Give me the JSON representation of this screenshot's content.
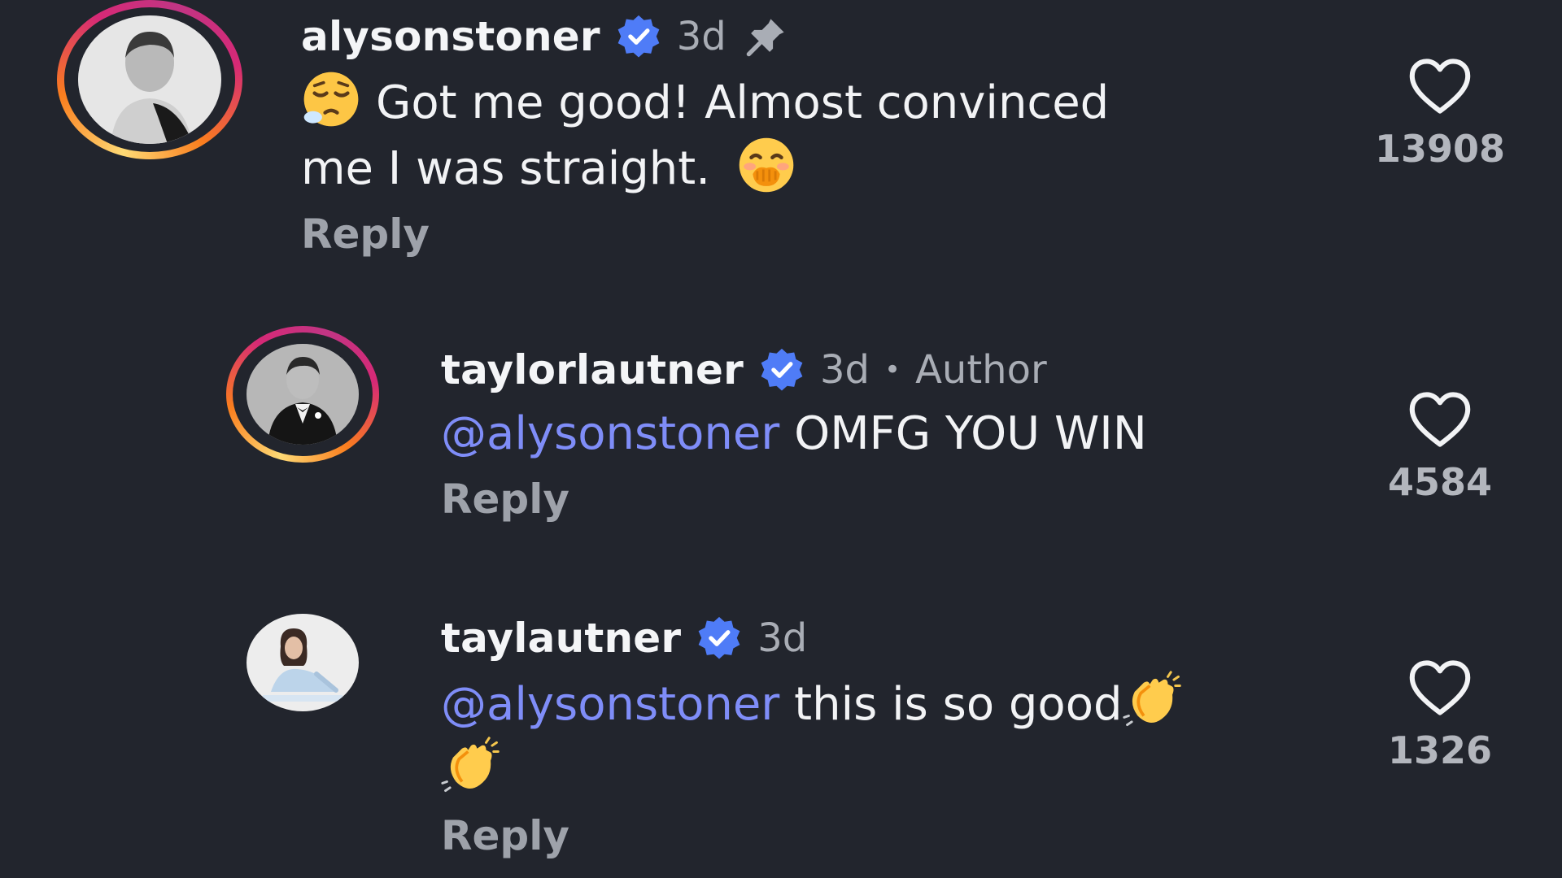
{
  "comments": [
    {
      "username": "alysonstoner",
      "time": "3d",
      "text": "Got me good! Almost convinced me I was straight.",
      "text_before": "Got me good! Almost convinced",
      "text_after": "me I was straight.",
      "reply_label": "Reply",
      "likes": "13908",
      "pinned": true,
      "icons": [
        "verified-badge-icon",
        "pin-icon",
        "sleepy-face-emoji",
        "hand-over-mouth-emoji",
        "heart-icon"
      ]
    },
    {
      "username": "taylorlautner",
      "time": "3d",
      "separator": "•",
      "role": "Author",
      "mention": "@alysonstoner",
      "text": "OMFG YOU WIN",
      "reply_label": "Reply",
      "likes": "4584",
      "icons": [
        "verified-badge-icon",
        "heart-icon"
      ]
    },
    {
      "username": "taylautner",
      "time": "3d",
      "mention": "@alysonstoner",
      "text": "this is so good",
      "reply_label": "Reply",
      "likes": "1326",
      "icons": [
        "verified-badge-icon",
        "clapping-hands-emoji",
        "heart-icon"
      ]
    }
  ],
  "colors": {
    "background": "#22252d",
    "mention": "#7f8df8",
    "verified": "#4f7cf7",
    "secondary_text": "#a9adb5"
  }
}
